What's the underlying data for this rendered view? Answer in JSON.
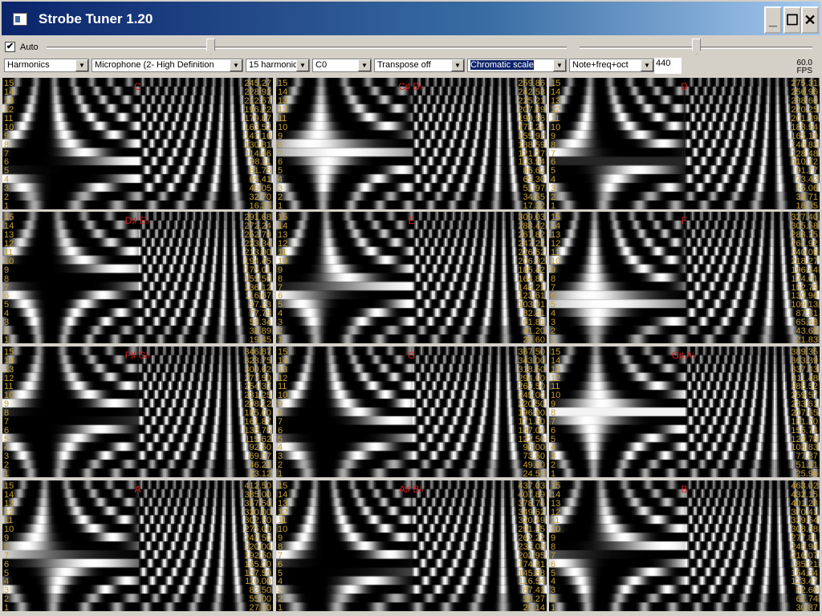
{
  "window": {
    "title": "Strobe Tuner 1.20",
    "minimize": "_",
    "maximize": "☐",
    "close": "✕"
  },
  "toolbar": {
    "auto_label": "Auto",
    "auto_checked": true,
    "check_mark": "✔",
    "selects": [
      "Harmonics",
      "Microphone (2- High Definition",
      "15 harmonic",
      "C0",
      "Transpose off",
      "Chromatic scale",
      "Note+freq+oct"
    ],
    "reference": "440",
    "fps_value": "60.0",
    "fps_label": "FPS",
    "arrow": "▼"
  },
  "harmonic_numbers": [
    "15",
    "14",
    "13",
    "12",
    "11",
    "10",
    "9",
    "8",
    "7",
    "6",
    "5",
    "4",
    "3",
    "2",
    "1"
  ],
  "panels": [
    {
      "note": "C",
      "freqs": [
        "245.27",
        "228.92",
        "212.57",
        "196.22",
        "179.87",
        "163.52",
        "147.16",
        "130.81",
        "114.46",
        "98.11",
        "81.76",
        "65.41",
        "49.05",
        "32.70",
        "16.35"
      ]
    },
    {
      "note": "C♯ D♭",
      "freqs": [
        "259.86",
        "242.53",
        "225.21",
        "207.89",
        "190.56",
        "173.24",
        "155.92",
        "138.59",
        "121.27",
        "103.94",
        "86.62",
        "69.30",
        "51.97",
        "34.65",
        "17.32"
      ]
    },
    {
      "note": "D",
      "freqs": [
        "275.31",
        "256.96",
        "238.60",
        "220.25",
        "201.89",
        "183.54",
        "165.19",
        "146.83",
        "128.48",
        "110.12",
        "91.77",
        "73.42",
        "55.06",
        "36.71",
        "18.35"
      ]
    },
    {
      "note": "D♯ E♭",
      "freqs": [
        "291.68",
        "272.24",
        "252.79",
        "233.34",
        "213.90",
        "194.45",
        "175.01",
        "155.56",
        "136.12",
        "116.67",
        "97.23",
        "77.78",
        "58.34",
        "38.89",
        "19.45"
      ]
    },
    {
      "note": "E",
      "freqs": [
        "309.03",
        "288.42",
        "267.82",
        "247.22",
        "226.62",
        "206.02",
        "185.42",
        "164.81",
        "144.21",
        "123.61",
        "103.01",
        "82.41",
        "61.81",
        "41.20",
        "20.60"
      ]
    },
    {
      "note": "F",
      "freqs": [
        "327.40",
        "305.58",
        "283.75",
        "261.92",
        "240.09",
        "218.27",
        "196.44",
        "174.61",
        "152.79",
        "130.96",
        "109.13",
        "87.31",
        "65.48",
        "43.65",
        "21.83"
      ]
    },
    {
      "note": "F♯ G♭",
      "freqs": [
        "346.87",
        "323.75",
        "300.62",
        "277.50",
        "254.37",
        "231.25",
        "208.12",
        "185.00",
        "161.87",
        "138.75",
        "115.62",
        "92.50",
        "69.37",
        "46.25",
        "23.12"
      ]
    },
    {
      "note": "G",
      "freqs": [
        "367.50",
        "343.00",
        "318.50",
        "294.00",
        "269.50",
        "245.00",
        "220.50",
        "196.00",
        "171.50",
        "147.00",
        "122.50",
        "98.00",
        "73.50",
        "49.00",
        "24.50"
      ]
    },
    {
      "note": "G♯ A♭",
      "freqs": [
        "389.35",
        "363.39",
        "337.43",
        "311.48",
        "285.52",
        "259.57",
        "233.61",
        "207.65",
        "181.70",
        "155.74",
        "129.78",
        "103.83",
        "77.87",
        "51.91",
        "25.96"
      ]
    },
    {
      "note": "A",
      "freqs": [
        "412.50",
        "385.00",
        "357.50",
        "330.00",
        "302.50",
        "275.00",
        "247.50",
        "220.00",
        "192.50",
        "165.00",
        "137.50",
        "110.00",
        "82.50",
        "55.00",
        "27.50"
      ]
    },
    {
      "note": "A♯ B♭",
      "freqs": [
        "437.03",
        "407.89",
        "378.76",
        "349.62",
        "320.49",
        "291.35",
        "262.22",
        "233.08",
        "203.95",
        "174.81",
        "145.68",
        "116.54",
        "87.41",
        "58.27",
        "29.14"
      ]
    },
    {
      "note": "B",
      "freqs": [
        "463.02",
        "432.15",
        "401.28",
        "370.41",
        "339.54",
        "308.68",
        "277.81",
        "246.94",
        "216.07",
        "185.21",
        "154.34",
        "123.47",
        "92.60",
        "61.74",
        "30.87"
      ]
    }
  ],
  "colors": {
    "note_label": "#d42020",
    "freq_text": "#c8a030",
    "selected_bg": "#0a246a"
  }
}
